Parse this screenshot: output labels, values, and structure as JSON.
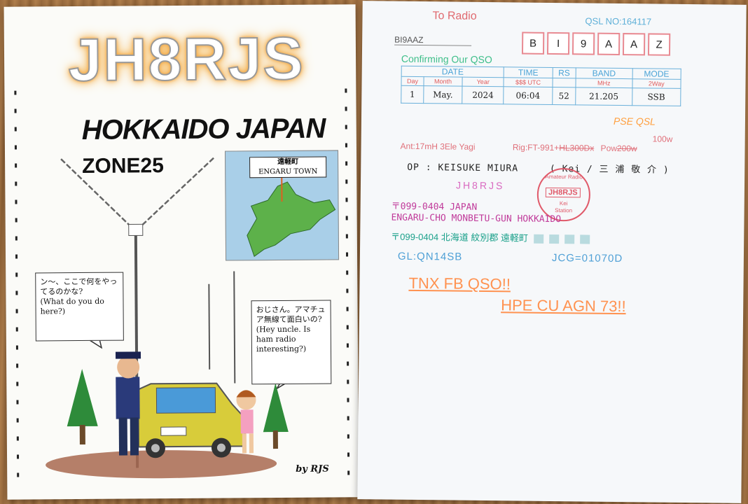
{
  "front": {
    "callsign": "JH8RJS",
    "location": "HOKKAIDO JAPAN",
    "zone": "ZONE25",
    "map_label_jp": "遠軽町",
    "map_label_en": "ENGARU TOWN",
    "bubble1_jp": "ン〜、ここで何をやってるのかな?",
    "bubble1_en": "(What do you do here?)",
    "bubble2_jp": "おじさん。アマチュア無線て面白いの?",
    "bubble2_en": "(Hey uncle. Is ham radio interesting?)",
    "credit": "by RJS"
  },
  "back": {
    "to_radio": "To Radio",
    "qsl_no": "QSL NO:164117",
    "to_call_hand": "BI9AAZ",
    "to_call_boxes": [
      "B",
      "I",
      "9",
      "A",
      "A",
      "Z"
    ],
    "confirming": "Confirming Our QSO",
    "table": {
      "headers": [
        "DATE",
        "TIME",
        "RS",
        "BAND",
        "MODE"
      ],
      "sub": {
        "day": "Day",
        "month": "Month",
        "year": "Year",
        "time": "$$$ UTC",
        "band": "MHz",
        "mode": "2Way"
      },
      "values": {
        "day": "1",
        "month": "May.",
        "year": "2024",
        "time": "06:04",
        "rs": "52",
        "band": "21.205",
        "mode": "SSB"
      }
    },
    "pse_qsl": "PSE QSL",
    "ant": "Ant:17mH 3Ele Yagi",
    "rig_prefix": "Rig:FT-991+",
    "rig_struck": "HL300Dx",
    "pow_prefix": "Pow",
    "pow_struck": "200w",
    "pow_new": "100w",
    "op": "OP : KEISUKE MIURA",
    "op_nick": "( Kei / 三 浦 敬 介 )",
    "callsign": "JH8RJS",
    "stamp": {
      "top": "Amateur Radio",
      "call": "JH8RJS",
      "name": "Kei",
      "bottom": "Station"
    },
    "addr1": "〒099-0404 JAPAN",
    "addr2": "ENGARU-CHO MONBETU-GUN HOKKAIDO",
    "addr3": "〒099-0404 北海道 紋別郡 遠軽町",
    "gl": "GL:QN14SB",
    "jcg": "JCG=01070D",
    "tnx1": "TNX FB QSO!!",
    "tnx2": "HPE CU AGN 73!!"
  }
}
